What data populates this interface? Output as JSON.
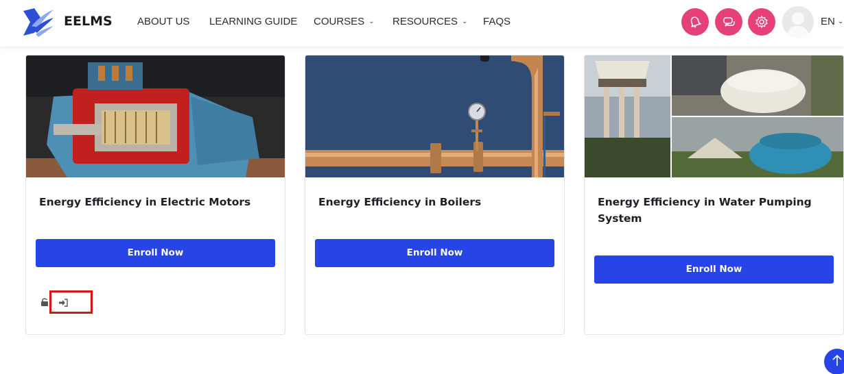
{
  "brand": {
    "name": "EELMS"
  },
  "nav": {
    "items": [
      {
        "label": "ABOUT US",
        "dropdown": false
      },
      {
        "label": "LEARNING GUIDE",
        "dropdown": false
      },
      {
        "label": "COURSES",
        "dropdown": true
      },
      {
        "label": "RESOURCES",
        "dropdown": true
      },
      {
        "label": "FAQS",
        "dropdown": false
      }
    ],
    "actions": [
      {
        "icon": "notification-bell-icon"
      },
      {
        "icon": "messages-chat-icon"
      },
      {
        "icon": "settings-gear-icon"
      }
    ],
    "language": "EN"
  },
  "courses": [
    {
      "title": "Energy Efficiency in Electric Motors",
      "enroll_label": "Enroll Now",
      "image": "electric-motor-cutaway-image",
      "status_icons": [
        "unlocked-icon",
        "sign-in-icon"
      ]
    },
    {
      "title": "Energy Efficiency in Boilers",
      "enroll_label": "Enroll Now",
      "image": "boiler-pipes-with-pressure-gauge-image"
    },
    {
      "title": "Energy Efficiency in Water Pumping System",
      "enroll_label": "Enroll Now",
      "image": "water-tanks-collage-image"
    }
  ],
  "colors": {
    "accent_blue": "#2744e6",
    "action_pink": "#e6407a",
    "highlight_red": "#d8131b"
  }
}
